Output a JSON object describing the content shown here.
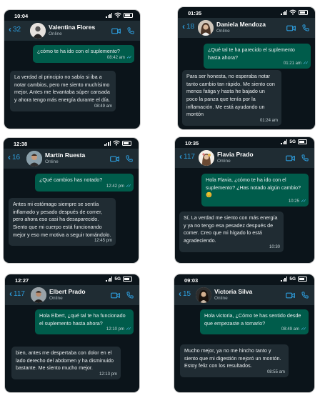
{
  "colors": {
    "chat_bg": "#0b141a",
    "header_bg": "#1f2c33",
    "outgoing": "#005c4b",
    "incoming": "#202c33",
    "accent": "#2d9cdb"
  },
  "icons": [
    "wifi-icon",
    "signal-icon",
    "battery-icon",
    "back-chevron-icon",
    "video-call-icon",
    "phone-call-icon",
    "read-ticks-icon"
  ],
  "chats": [
    {
      "time": "10:04",
      "network": "",
      "back_count": "32",
      "name": "Valentina Flores",
      "status": "Online",
      "out_text": "¿cómo te ha ido con el suplemento?",
      "out_time": "08:42 am",
      "in_text": "La verdad al principio no sabía si iba a notar cambios, pero me siento muchísimo mejor. Antes me levantaba súper cansada y ahora tengo más energía durante el día.",
      "in_time": "08:49 am"
    },
    {
      "time": "01:35",
      "network": "",
      "back_count": "18",
      "name": "Daniela Mendoza",
      "status": "Online",
      "out_text": "¿Qué tal te ha parecido el suplemento hasta ahora?",
      "out_time": "01:21 am",
      "in_text": "Para ser honesta, no esperaba notar tanto cambio tan rápido. Me siento con menos fatiga y hasta he bajado un poco la panza que tenía por la inflamación. Me está ayudando un montón",
      "in_time": "01:24 am"
    },
    {
      "time": "12:38",
      "network": "",
      "back_count": "16",
      "name": "Martín Ruesta",
      "status": "Online",
      "out_text": "¿Qué cambios has notado?",
      "out_time": "12:42 pm",
      "in_text": "Antes mi estómago siempre se sentía inflamado y pesado después de comer, pero ahora eso casi ha desaparecido. Siento que mi cuerpo está funcionando mejor y eso me motiva a seguir tomándolo.",
      "in_time": "12:45 pm"
    },
    {
      "time": "10:35",
      "network": "5G",
      "back_count": "117",
      "name": "Flavia Prado",
      "status": "Online",
      "out_text": "Hola Flavia, ¿cómo te ha ido con el suplemento? ¿Has notado algún cambio? 😊",
      "out_time": "10:25",
      "in_text": "Sí, La verdad me siento con más energía y ya no tengo esa pesadez después de comer. Creo que mi hígado lo está agradeciendo.",
      "in_time": "10:30"
    },
    {
      "time": "12:27",
      "network": "5G",
      "back_count": "117",
      "name": "Elbert Prado",
      "status": "Online",
      "out_text": "Hola Elbert, ¿qué tal te ha funcionado el suplemento hasta ahora?",
      "out_time": "12:10 pm",
      "in_text": "bien, antes me despertaba con dolor en el lado derecho del abdomen y ha disminuido bastante. Me siento mucho mejor.",
      "in_time": "12:13 pm"
    },
    {
      "time": "09:03",
      "network": "5G",
      "back_count": "15",
      "name": "Victoria Silva",
      "status": "Online",
      "out_text": "Hola victoria, ¿Cómo te has sentido desde que empezaste a tomarlo?",
      "out_time": "08:49 am",
      "in_text": "Mucho mejor, ya no me hincho tanto y siento que mi digestión mejoró un montón. Estoy feliz con los resultados.",
      "in_time": "08:55 am"
    }
  ]
}
